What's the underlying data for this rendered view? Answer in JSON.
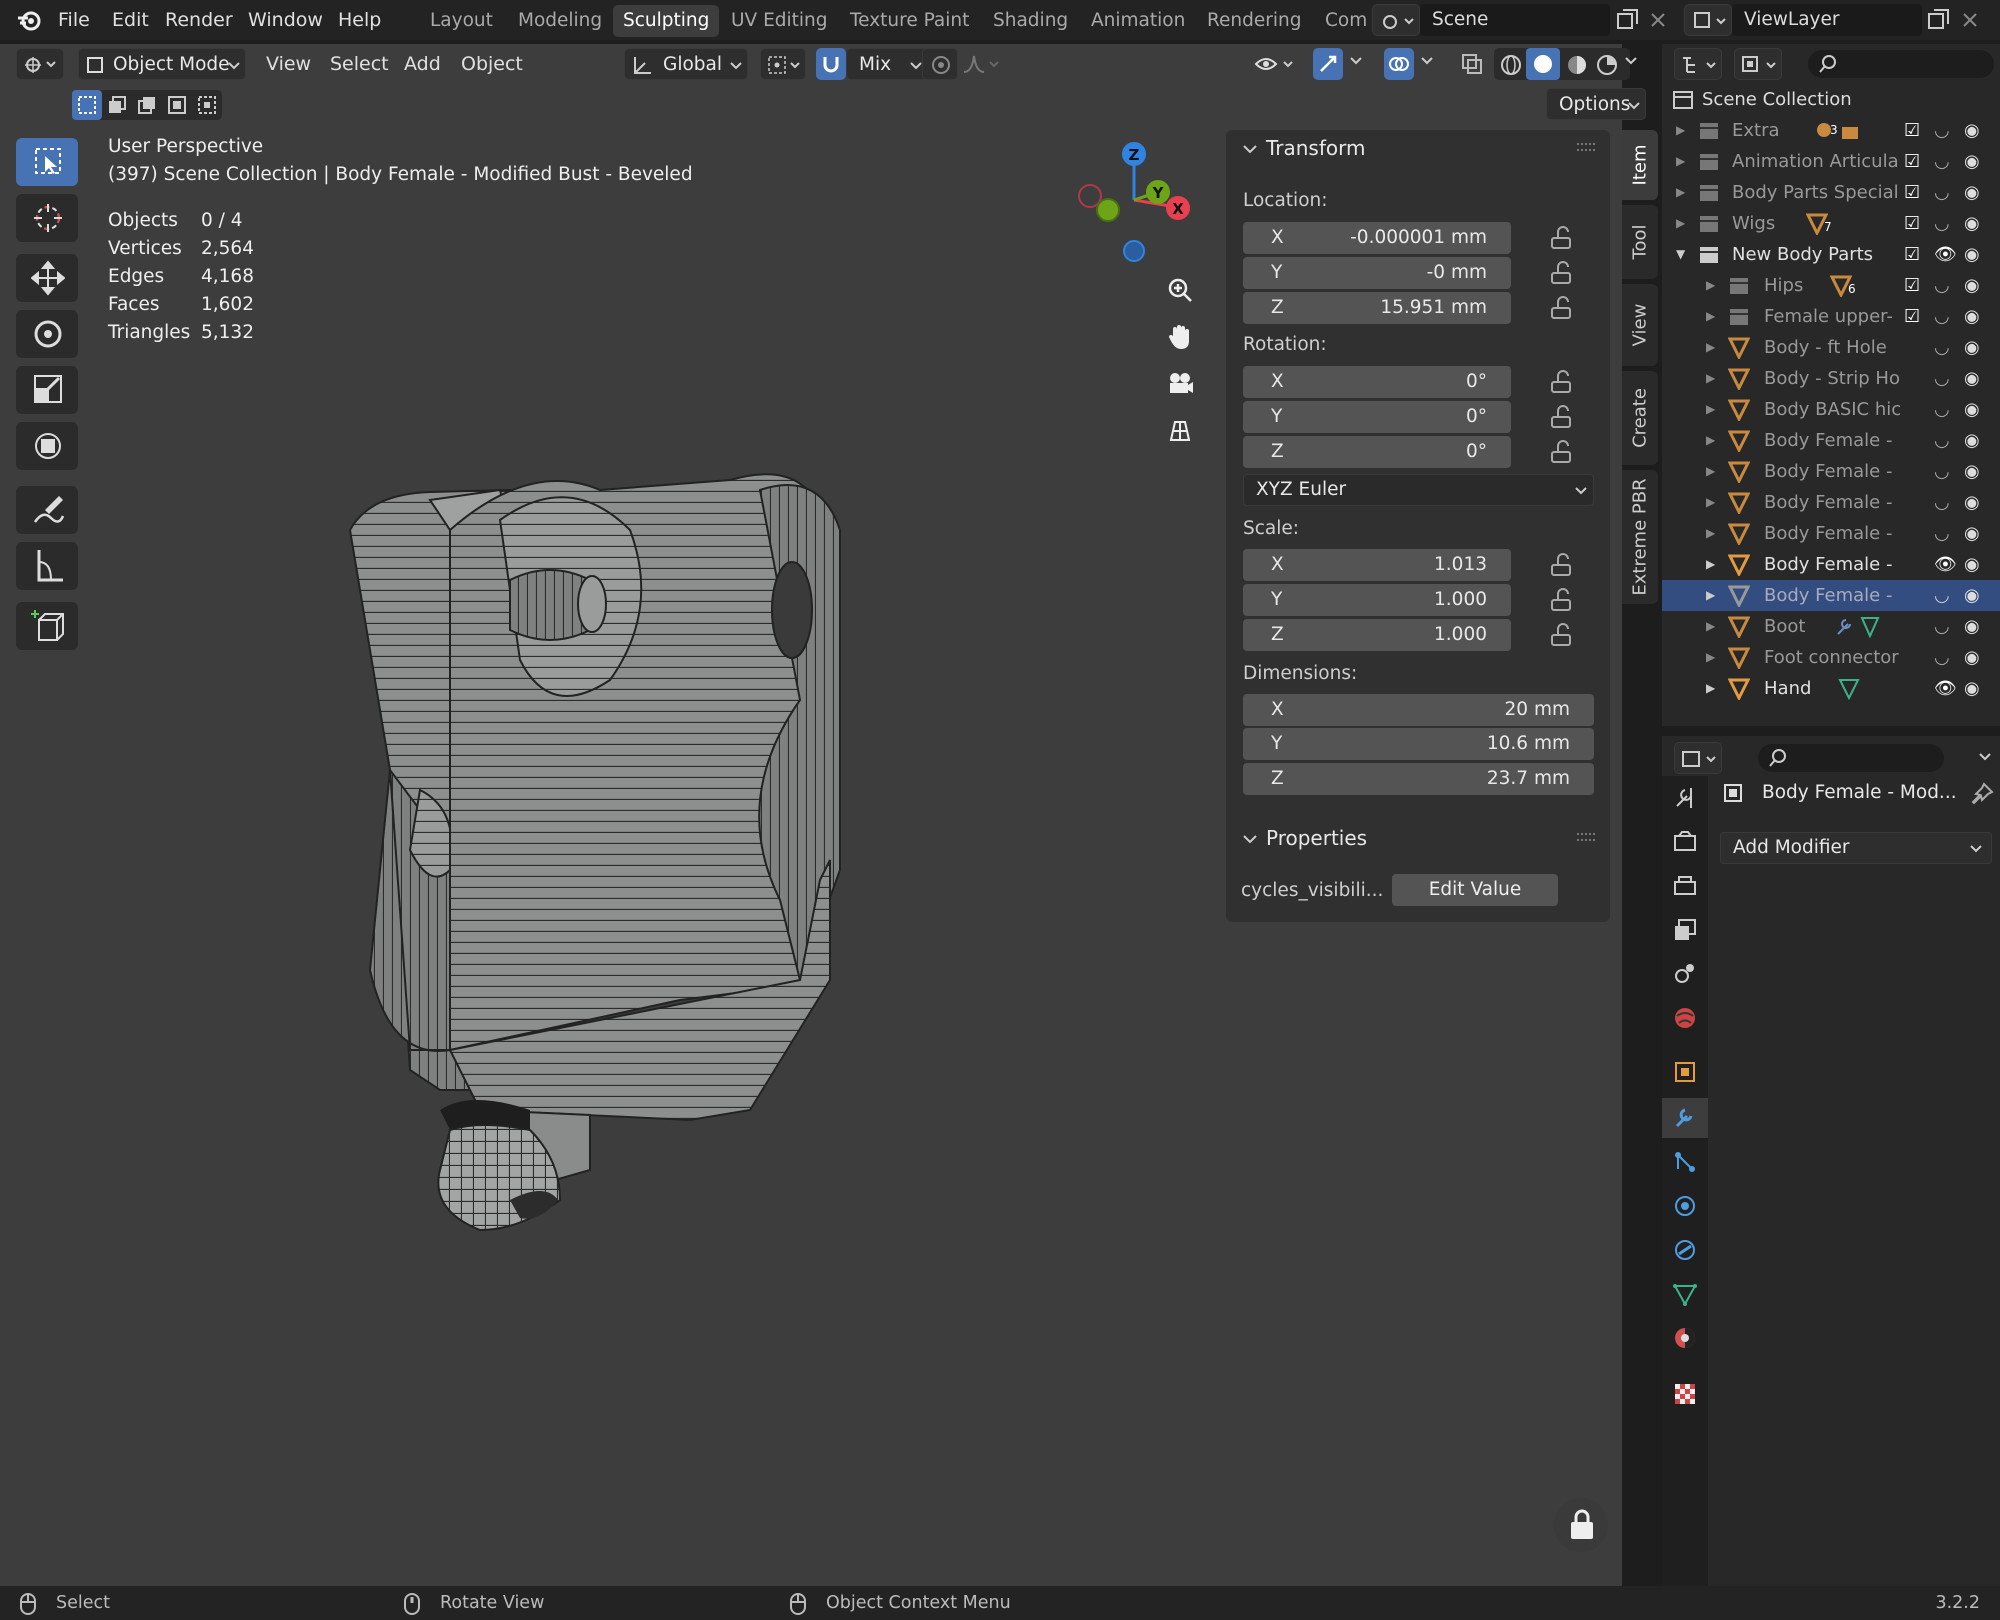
{
  "topbar": {
    "menus": [
      "File",
      "Edit",
      "Render",
      "Window",
      "Help"
    ],
    "workspaces": [
      "Layout",
      "Modeling",
      "Sculpting",
      "UV Editing",
      "Texture Paint",
      "Shading",
      "Animation",
      "Rendering",
      "Com"
    ],
    "active_workspace": "Sculpting",
    "scene": "Scene",
    "view_layer": "ViewLayer"
  },
  "header": {
    "mode": "Object Mode",
    "menus": [
      "View",
      "Select",
      "Add",
      "Object"
    ],
    "orientation": "Global",
    "snap": "Mix",
    "options": "Options"
  },
  "viewport": {
    "perspective": "User Perspective",
    "context": "(397) Scene Collection | Body Female - Modified Bust - Beveled",
    "stats": [
      {
        "label": "Objects",
        "value": "0 / 4"
      },
      {
        "label": "Vertices",
        "value": "2,564"
      },
      {
        "label": "Edges",
        "value": "4,168"
      },
      {
        "label": "Faces",
        "value": "1,602"
      },
      {
        "label": "Triangles",
        "value": "5,132"
      }
    ],
    "gizmo": {
      "x": "X",
      "y": "Y",
      "z": "Z"
    }
  },
  "npanel": {
    "tabs": [
      "Item",
      "Tool",
      "View",
      "Create",
      "Extreme PBR"
    ],
    "transform_title": "Transform",
    "location_label": "Location:",
    "location": [
      {
        "axis": "X",
        "value": "-0.000001 mm"
      },
      {
        "axis": "Y",
        "value": "-0 mm"
      },
      {
        "axis": "Z",
        "value": "15.951 mm"
      }
    ],
    "rotation_label": "Rotation:",
    "rotation": [
      {
        "axis": "X",
        "value": "0°"
      },
      {
        "axis": "Y",
        "value": "0°"
      },
      {
        "axis": "Z",
        "value": "0°"
      }
    ],
    "rotation_mode": "XYZ Euler",
    "scale_label": "Scale:",
    "scale": [
      {
        "axis": "X",
        "value": "1.013"
      },
      {
        "axis": "Y",
        "value": "1.000"
      },
      {
        "axis": "Z",
        "value": "1.000"
      }
    ],
    "dimensions_label": "Dimensions:",
    "dimensions": [
      {
        "axis": "X",
        "value": "20 mm"
      },
      {
        "axis": "Y",
        "value": "10.6 mm"
      },
      {
        "axis": "Z",
        "value": "23.7 mm"
      }
    ],
    "properties_title": "Properties",
    "prop_name": "cycles_visibili...",
    "edit_value": "Edit Value"
  },
  "outliner": {
    "root": "Scene Collection",
    "items": [
      {
        "name": "Extra",
        "badge": "3"
      },
      {
        "name": "Animation Articula"
      },
      {
        "name": "Body Parts Special"
      },
      {
        "name": "Wigs",
        "badge": "7"
      },
      {
        "name": "New Body Parts"
      },
      {
        "name": "Hips",
        "badge": "6"
      },
      {
        "name": "Female upper-"
      },
      {
        "name": "Body - ft Hole"
      },
      {
        "name": "Body - Strip Ho"
      },
      {
        "name": "Body BASIC hic"
      },
      {
        "name": "Body Female -"
      },
      {
        "name": "Body Female -"
      },
      {
        "name": "Body Female -"
      },
      {
        "name": "Body Female -"
      },
      {
        "name": "Body Female -"
      },
      {
        "name": "Body Female -"
      },
      {
        "name": "Boot"
      },
      {
        "name": "Foot connector"
      },
      {
        "name": "Hand"
      }
    ]
  },
  "properties": {
    "object_name": "Body Female - Mod...",
    "add_modifier": "Add Modifier"
  },
  "status": {
    "select": "Select",
    "rotate": "Rotate View",
    "context": "Object Context Menu",
    "version": "3.2.2"
  },
  "colors": {
    "accent": "#4772b3",
    "x_axis": "#e8404f",
    "y_axis": "#6ea418",
    "z_axis": "#2f84e3",
    "mesh_orange": "#e49a3e"
  }
}
